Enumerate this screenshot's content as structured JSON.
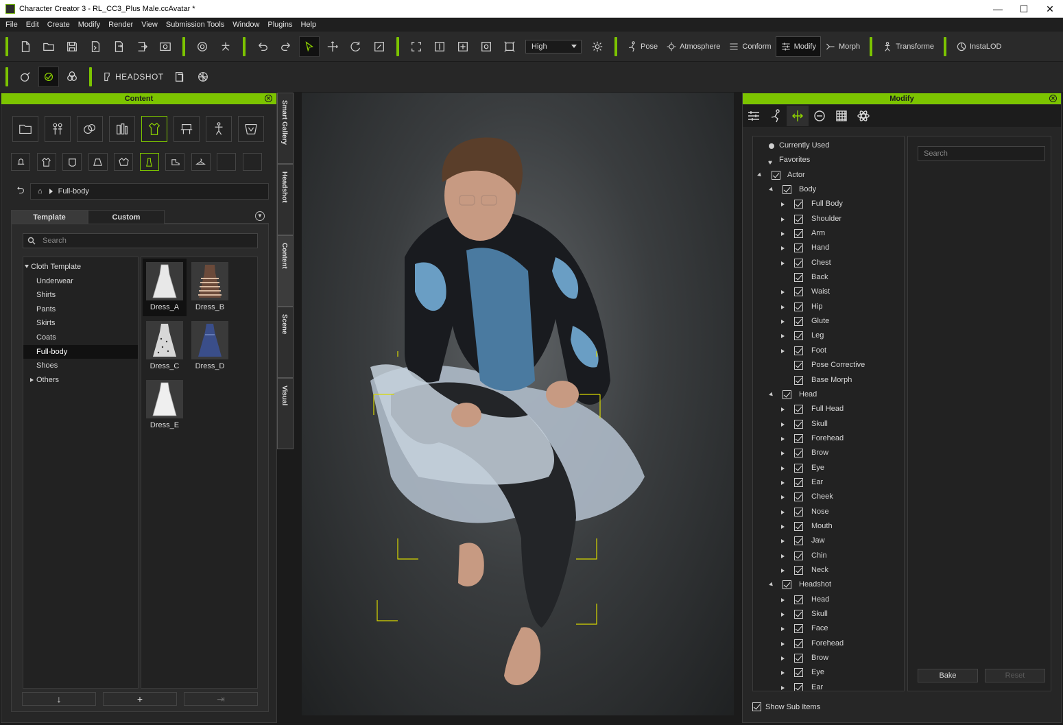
{
  "window": {
    "title": "Character Creator 3 - RL_CC3_Plus Male.ccAvatar *",
    "controls": [
      "—",
      "☐",
      "✕"
    ]
  },
  "menu": [
    "File",
    "Edit",
    "Create",
    "Modify",
    "Render",
    "View",
    "Submission Tools",
    "Window",
    "Plugins",
    "Help"
  ],
  "toolbar": {
    "quality": "High",
    "pose": "Pose",
    "atmosphere": "Atmosphere",
    "conform": "Conform",
    "modify": "Modify",
    "morph": "Morph",
    "transform": "Transforme",
    "instalod": "InstaLOD",
    "headshot": "HEADSHOT"
  },
  "content_panel": {
    "header": "Content",
    "path": "Full-body",
    "tabs": [
      "Template",
      "Custom"
    ],
    "search_placeholder": "Search",
    "tree": {
      "root": "Cloth Template",
      "items": [
        "Underwear",
        "Shirts",
        "Pants",
        "Skirts",
        "Coats",
        "Full-body",
        "Shoes",
        "Others"
      ],
      "selected": "Full-body"
    },
    "thumbnails": [
      "Dress_A",
      "Dress_B",
      "Dress_C",
      "Dress_D",
      "Dress_E"
    ],
    "selected_thumbnail": "Dress_A",
    "bottom_buttons": [
      "↓",
      "+",
      "⇥"
    ]
  },
  "side_tabs": [
    "Smart Gallery",
    "Headshot",
    "Content",
    "Scene",
    "Visual"
  ],
  "modify_panel": {
    "header": "Modify",
    "search_placeholder": "Search",
    "bake": "Bake",
    "reset": "Reset",
    "show_sub_items": "Show Sub Items",
    "currently_used": "Currently Used",
    "favorites": "Favorites",
    "actor": "Actor",
    "body": "Body",
    "body_items": [
      "Full Body",
      "Shoulder",
      "Arm",
      "Hand",
      "Chest",
      "Back",
      "Waist",
      "Hip",
      "Glute",
      "Leg",
      "Foot",
      "Pose Corrective",
      "Base Morph"
    ],
    "head": "Head",
    "head_items": [
      "Full Head",
      "Skull",
      "Forehead",
      "Brow",
      "Eye",
      "Ear",
      "Cheek",
      "Nose",
      "Mouth",
      "Jaw",
      "Chin",
      "Neck"
    ],
    "headshot": "Headshot",
    "headshot_items": [
      "Head",
      "Skull",
      "Face",
      "Forehead",
      "Brow",
      "Eye",
      "Ear"
    ]
  },
  "colors": {
    "accent": "#7cc400",
    "panel_bg": "#262626",
    "viewport_center": "#5f6366"
  }
}
